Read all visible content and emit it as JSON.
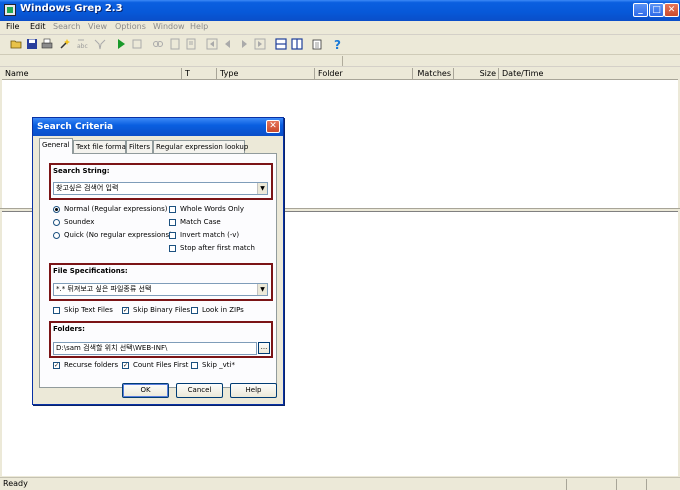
{
  "window": {
    "title": "Windows Grep 2.3",
    "min": "_",
    "max": "□",
    "close": "✕"
  },
  "menu": [
    "File",
    "Edit",
    "Search",
    "View",
    "Options",
    "Window",
    "Help"
  ],
  "columns": [
    "Name",
    "T",
    "Type",
    "Folder",
    "Matches",
    "Size",
    "Date/Time"
  ],
  "status": "Ready",
  "dialog": {
    "title": "Search Criteria",
    "close": "✕",
    "tabs": [
      "General",
      "Text file format",
      "Filters",
      "Regular expression lookup"
    ],
    "search_string_label": "Search String:",
    "search_string_value": "찾고싶은 검색어 입력",
    "modes": [
      {
        "label": "Normal (Regular expressions)",
        "selected": true
      },
      {
        "label": "Soundex",
        "selected": false
      },
      {
        "label": "Quick (No regular expressions)",
        "selected": false
      }
    ],
    "options": [
      {
        "label": "Whole Words Only",
        "checked": false
      },
      {
        "label": "Match Case",
        "checked": false
      },
      {
        "label": "Invert match (-v)",
        "checked": false
      },
      {
        "label": "Stop after first match",
        "checked": false
      }
    ],
    "file_spec_label": "File Specifications:",
    "file_spec_value": "*.*  뒤져보고 싶은 파일종류  선택",
    "file_checks": [
      {
        "label": "Skip Text Files",
        "checked": false
      },
      {
        "label": "Skip Binary Files",
        "checked": true
      },
      {
        "label": "Look in ZIPs",
        "checked": false
      }
    ],
    "folders_label": "Folders:",
    "folders_value": "D:\\sam 검색할 위치 선택\\WEB-INF\\",
    "browse": "...",
    "folder_checks": [
      {
        "label": "Recurse folders",
        "checked": true
      },
      {
        "label": "Count Files First",
        "checked": true
      },
      {
        "label": "Skip _vti*",
        "checked": false
      }
    ],
    "ok": "OK",
    "cancel": "Cancel",
    "help": "Help",
    "dropdown": "▼",
    "checkmark": "✓"
  }
}
